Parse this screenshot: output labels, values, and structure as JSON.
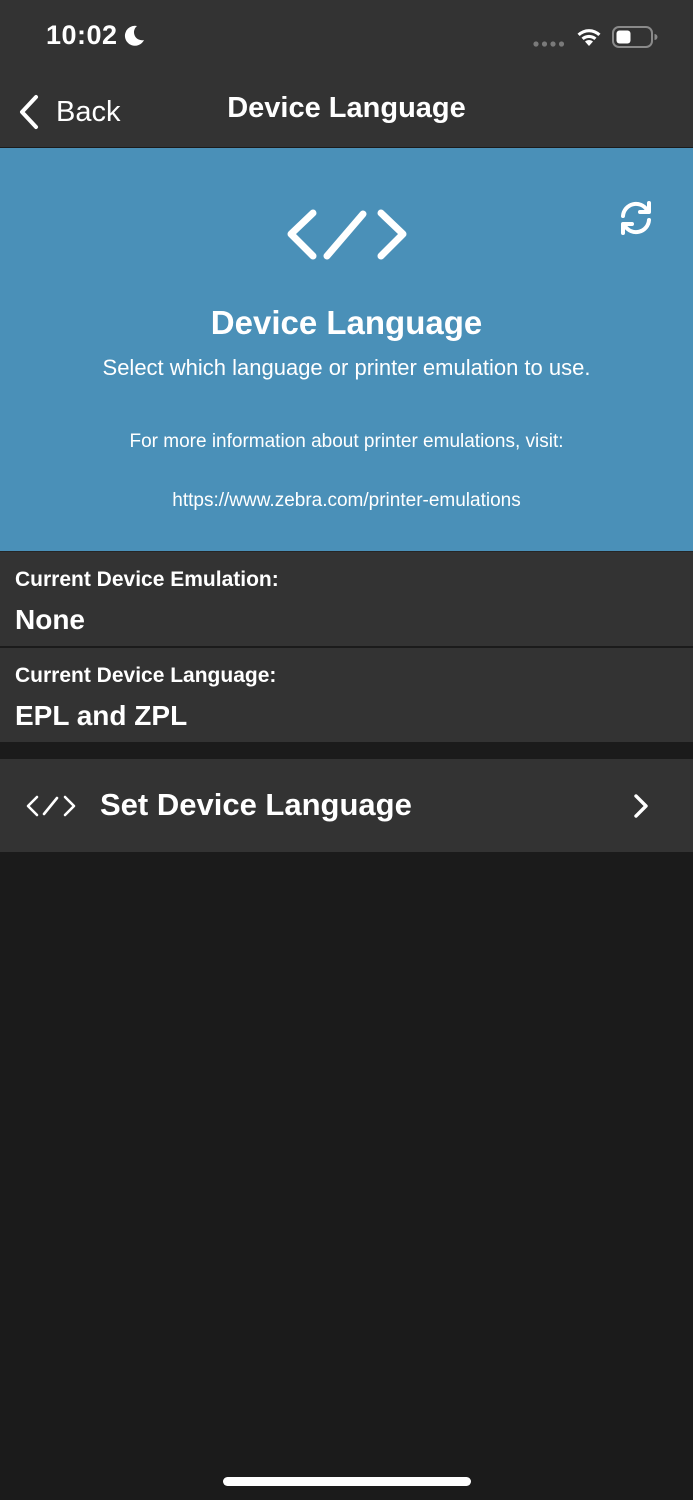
{
  "status_bar": {
    "time": "10:02",
    "moon_icon": "moon-icon",
    "signal_icon": "cellular-signal-icon",
    "wifi_icon": "wifi-icon",
    "battery_icon": "battery-icon"
  },
  "nav": {
    "back_label": "Back",
    "title": "Device Language"
  },
  "hero": {
    "icon": "code-brackets-icon",
    "refresh_icon": "refresh-icon",
    "title": "Device Language",
    "subtitle": "Select which language or printer emulation to use.",
    "info": "For more information about printer emulations, visit:",
    "link": "https://www.zebra.com/printer-emulations"
  },
  "device_info": {
    "emulation_label": "Current Device Emulation:",
    "emulation_value": "None",
    "language_label": "Current Device Language:",
    "language_value": "EPL and ZPL"
  },
  "action": {
    "icon": "code-brackets-icon",
    "label": "Set Device Language",
    "chevron_icon": "chevron-right-icon"
  },
  "colors": {
    "background": "#1b1b1b",
    "bar": "#333333",
    "hero_blue": "#4a90b8",
    "text": "#ffffff"
  }
}
